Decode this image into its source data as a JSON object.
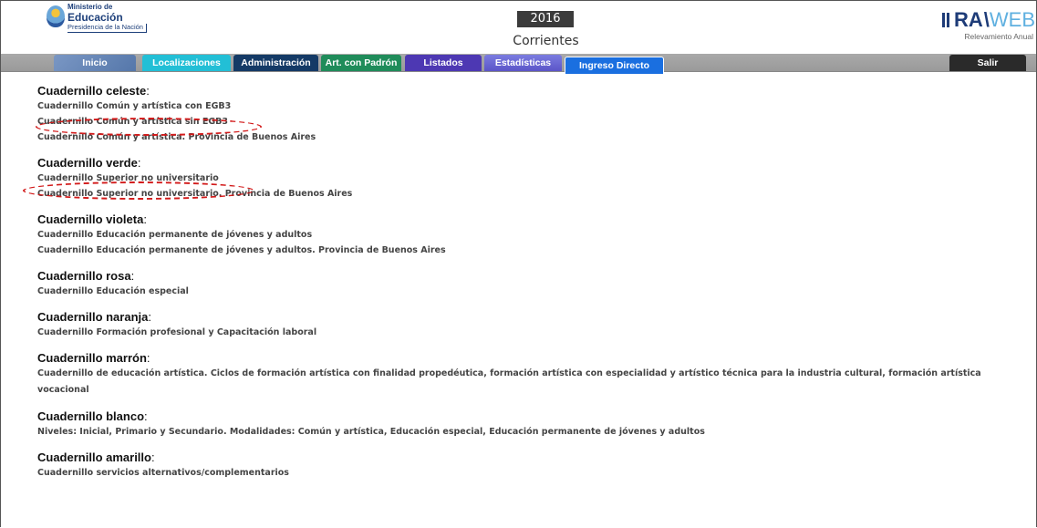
{
  "header": {
    "ministry_l1": "Ministerio de",
    "ministry_l2": "Educación",
    "ministry_l3": "Presidencia de la Nación",
    "year": "2016",
    "province": "Corrientes",
    "brand_ra": "RA",
    "brand_web": "WEB",
    "brand_sub": "Relevamiento Anual"
  },
  "nav": {
    "inicio": "Inicio",
    "localizaciones": "Localizaciones",
    "administracion": "Administración",
    "art_padron": "Art. con Padrón",
    "listados": "Listados",
    "estadisticas": "Estadísticas",
    "ingreso_directo": "Ingreso Directo",
    "salir": "Salir"
  },
  "sections": [
    {
      "title": "Cuadernillo celeste",
      "items": [
        "Cuadernillo Común y artística con EGB3",
        "Cuadernillo Común y artística sin EGB3",
        "Cuadernillo Común y artística. Provincia de Buenos Aires"
      ]
    },
    {
      "title": "Cuadernillo verde",
      "items": [
        "Cuadernillo Superior no universitario",
        "Cuadernillo Superior no universitario. Provincia de Buenos Aires"
      ]
    },
    {
      "title": "Cuadernillo violeta",
      "items": [
        "Cuadernillo Educación permanente de jóvenes y adultos",
        "Cuadernillo Educación permanente de jóvenes y adultos. Provincia de Buenos Aires"
      ]
    },
    {
      "title": "Cuadernillo rosa",
      "items": [
        "Cuadernillo Educación especial"
      ]
    },
    {
      "title": "Cuadernillo naranja",
      "items": [
        "Cuadernillo Formación profesional y Capacitación laboral"
      ]
    },
    {
      "title": "Cuadernillo marrón",
      "items": [
        "Cuadernillo de educación artística. Ciclos de formación artística con finalidad propedéutica, formación artística con especialidad y artístico técnica para la industria cultural, formación artística vocacional"
      ]
    },
    {
      "title": "Cuadernillo blanco",
      "items": [
        "Niveles: Inicial, Primario y Secundario. Modalidades: Común y artística, Educación especial, Educación permanente de jóvenes y adultos"
      ]
    },
    {
      "title": "Cuadernillo amarillo",
      "items": [
        "Cuadernillo servicios alternativos/complementarios"
      ]
    }
  ],
  "colon": ":"
}
